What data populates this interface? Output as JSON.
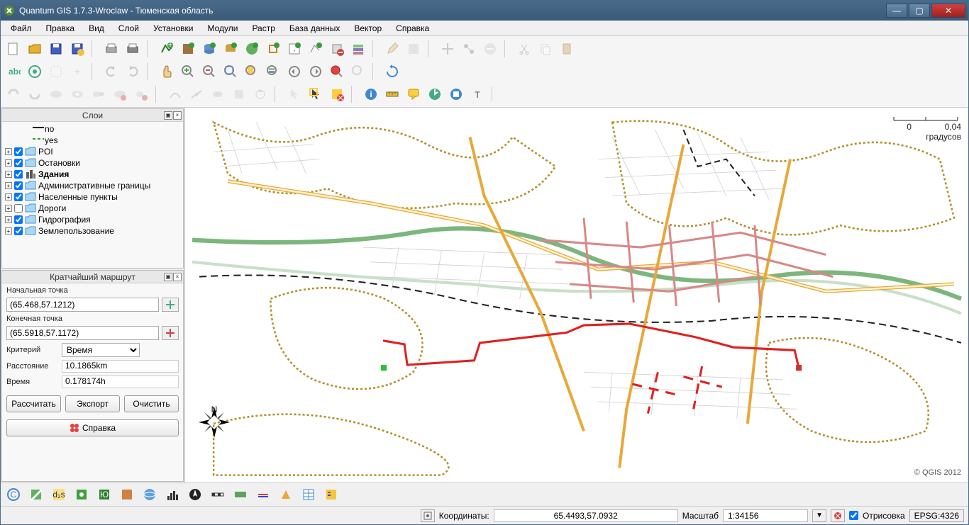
{
  "window": {
    "title": "Quantum GIS 1.7.3-Wroclaw - Тюменская область"
  },
  "menubar": [
    "Файл",
    "Правка",
    "Вид",
    "Слой",
    "Установки",
    "Модули",
    "Растр",
    "База данных",
    "Вектор",
    "Справка"
  ],
  "panels": {
    "layers_title": "Слои",
    "route_title": "Кратчайший маршрут"
  },
  "layers": [
    {
      "level": 1,
      "expand": null,
      "checked": null,
      "icon": "line-black",
      "label": "no"
    },
    {
      "level": 1,
      "expand": null,
      "checked": null,
      "icon": "line-green-dash",
      "label": "yes"
    },
    {
      "level": 0,
      "expand": "+",
      "checked": true,
      "icon": "folder",
      "label": "POI"
    },
    {
      "level": 0,
      "expand": "+",
      "checked": true,
      "icon": "folder",
      "label": "Остановки"
    },
    {
      "level": 0,
      "expand": "+",
      "checked": true,
      "icon": "buildings",
      "label": "Здания",
      "bold": true
    },
    {
      "level": 0,
      "expand": "+",
      "checked": true,
      "icon": "folder",
      "label": "Административные границы"
    },
    {
      "level": 0,
      "expand": "+",
      "checked": true,
      "icon": "folder",
      "label": "Населенные пункты"
    },
    {
      "level": 0,
      "expand": "+",
      "checked": false,
      "icon": "folder",
      "label": "Дороги"
    },
    {
      "level": 0,
      "expand": "+",
      "checked": true,
      "icon": "folder",
      "label": "Гидрография"
    },
    {
      "level": 0,
      "expand": "+",
      "checked": true,
      "icon": "folder",
      "label": "Землепользование"
    }
  ],
  "route": {
    "start_label": "Начальная точка",
    "start_value": "(65.468,57.1212)",
    "end_label": "Конечная точка",
    "end_value": "(65.5918,57.1172)",
    "criterion_label": "Критерий",
    "criterion_value": "Время",
    "distance_label": "Расстояние",
    "distance_value": "10.1865km",
    "time_label": "Время",
    "time_value": "0.178174h",
    "calc": "Рассчитать",
    "export": "Экспорт",
    "clear": "Очистить",
    "help": "Справка"
  },
  "scale_bar": {
    "tick0": "0",
    "tick1": "0,04",
    "unit": "градусов"
  },
  "credit": "© QGIS 2012",
  "statusbar": {
    "coords_label": "Координаты:",
    "coords_value": "65.4493,57.0932",
    "scale_label": "Масштаб",
    "scale_value": "1:34156",
    "render_label": "Отрисовка",
    "epsg": "EPSG:4326"
  }
}
